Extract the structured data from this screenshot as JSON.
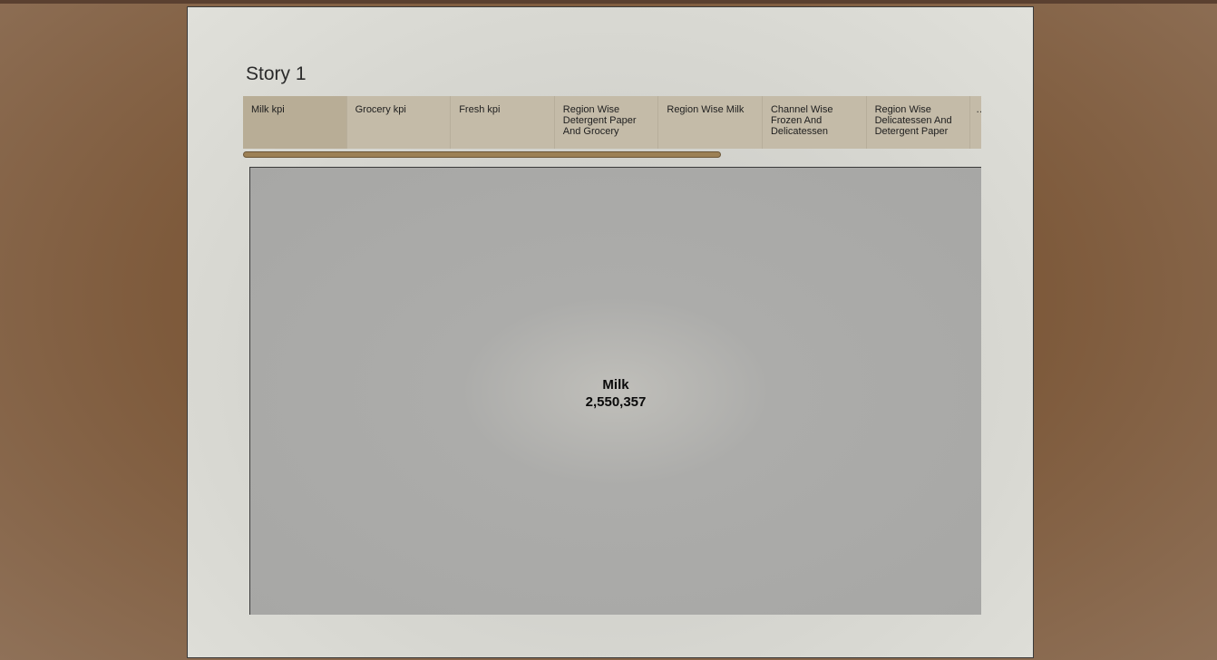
{
  "story": {
    "title": "Story 1"
  },
  "tabs": [
    {
      "label": "Milk kpi",
      "active": true
    },
    {
      "label": "Grocery kpi",
      "active": false
    },
    {
      "label": "Fresh kpi",
      "active": false
    },
    {
      "label": "Region Wise Detergent Paper And Grocery",
      "active": false
    },
    {
      "label": "Region Wise Milk",
      "active": false
    },
    {
      "label": "Channel Wise Frozen And Delicatessen",
      "active": false
    },
    {
      "label": "Region Wise Delicatessen And Detergent Paper",
      "active": false
    }
  ],
  "tabs_overflow": "…",
  "kpi": {
    "label": "Milk",
    "value": "2,550,357"
  },
  "colors": {
    "tab_strip": "#c4bba8",
    "active_tab": "#b8ad96",
    "scrollbar": "#9c8055",
    "viz_background": "#a7a7a5"
  }
}
